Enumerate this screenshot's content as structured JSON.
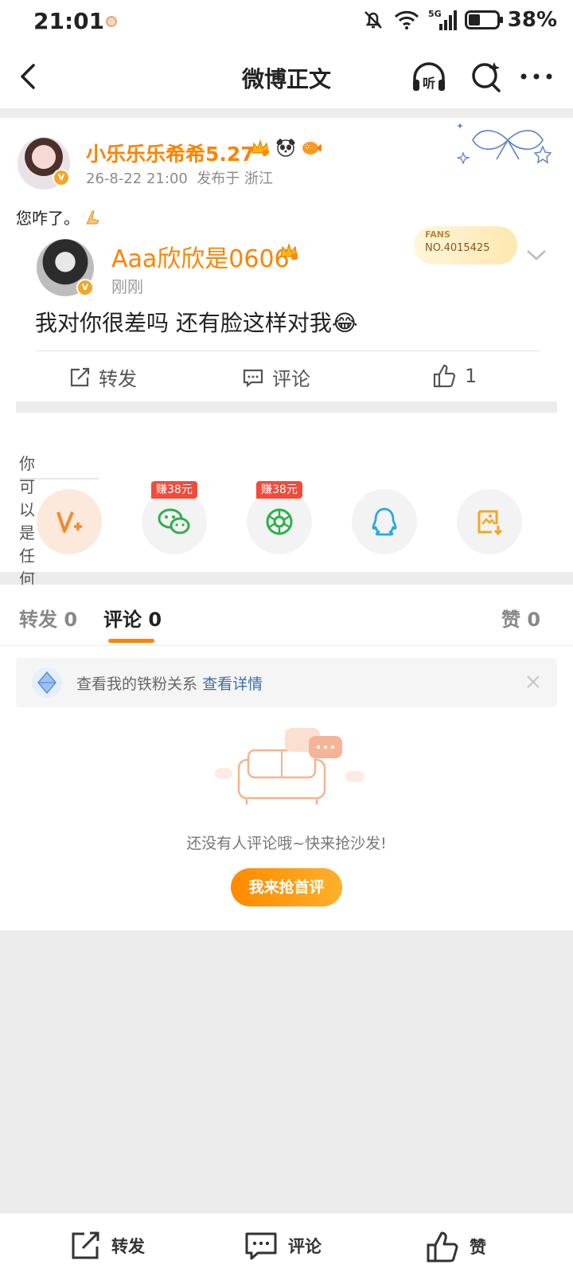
{
  "status_bar": {
    "time": "21:01",
    "battery": "38%",
    "network": "5G"
  },
  "nav": {
    "title": "微博正文",
    "listen_label": "听"
  },
  "post": {
    "author": "小乐乐乐希希5.27",
    "meta": "26-8-22 21:00  发布于 浙江",
    "text": "您咋了。",
    "verify_mark": "v"
  },
  "quote": {
    "author": "Aaa欣欣是0606",
    "time": "刚刚",
    "text": "我对你很差吗 还有脸这样对我😂",
    "fans_card": {
      "label": "FANS",
      "number": "NO.4015425"
    },
    "actions": {
      "repost": "转发",
      "comment": "评论",
      "like_count": "1"
    }
  },
  "share": {
    "tip": "你可以是任何💜💙",
    "wechat_tag": "赚38元",
    "moments_tag": "赚38元",
    "items": [
      "v-plus-icon",
      "wechat-icon",
      "moments-icon",
      "qq-icon",
      "save-image-icon"
    ]
  },
  "comments": {
    "tabs": [
      {
        "label": "转发 0"
      },
      {
        "label": "评论 0"
      },
      {
        "label": "赞 0"
      }
    ],
    "banner_text": "查看我的铁粉关系",
    "banner_link": "查看详情",
    "empty_text": "还没有人评论哦~快来抢沙发!",
    "first_button": "我来抢首评"
  },
  "bottom_bar": {
    "repost": "转发",
    "comment": "评论",
    "like": "赞"
  },
  "colors": {
    "accent": "#ff8200",
    "link": "#3d6fa6",
    "earn_tag": "#f24b3c"
  }
}
